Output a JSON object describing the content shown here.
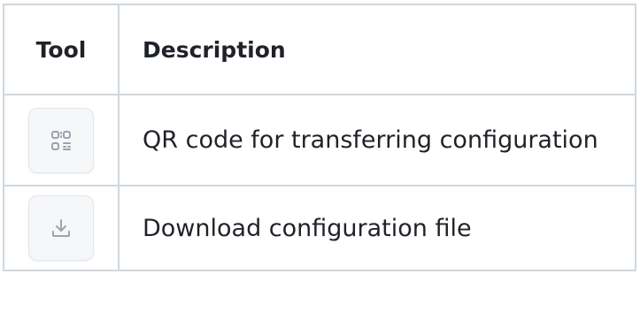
{
  "table": {
    "headers": {
      "tool": "Tool",
      "description": "Description"
    },
    "rows": [
      {
        "icon": "qr-code-icon",
        "description": "QR code for transferring configuration"
      },
      {
        "icon": "download-icon",
        "description": "Download configuration file"
      }
    ]
  },
  "colors": {
    "border": "#d0d7de",
    "icon": "#9aa3ad",
    "button_bg": "#f6f7f9",
    "text": "#1f2328"
  }
}
